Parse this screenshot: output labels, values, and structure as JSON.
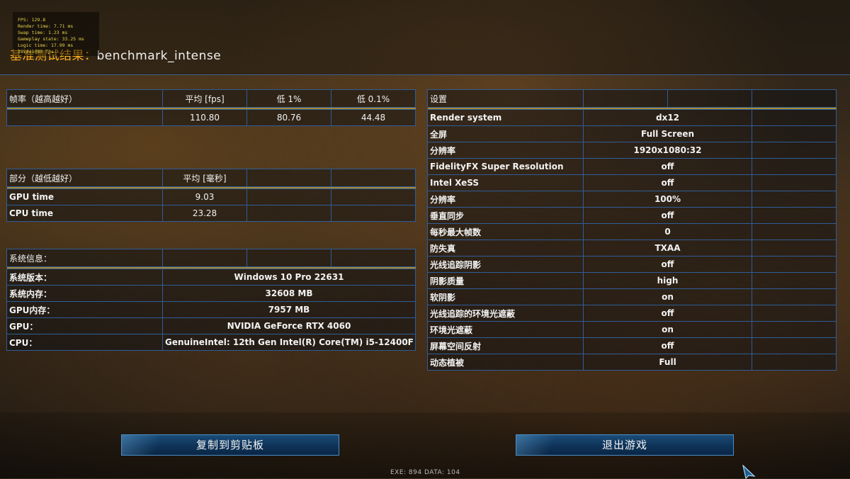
{
  "page_title_prefix": "基准测试结果：",
  "page_title_name": "benchmark_intense",
  "perf_overlay": {
    "fps": "FPS: 129.8",
    "render_time": "Render time: 7.71 ms",
    "swap_time": "Swap time: 1.23 ms",
    "gameplay_state": "Gameplay state: 33.25 ms",
    "logic_time": "Logic time: 17.99 ms",
    "resolution": "1920x1080 fps"
  },
  "fps_table": {
    "header": {
      "label": "帧率（越高越好）",
      "avg": "平均 [fps]",
      "low1": "低 1%",
      "low01": "低 0.1%"
    },
    "row": {
      "avg": "110.80",
      "low1": "80.76",
      "low01": "44.48"
    }
  },
  "parts_table": {
    "header": {
      "label": "部分（越低越好）",
      "avg": "平均 [毫秒]"
    },
    "rows": [
      {
        "label": "GPU time",
        "value": "9.03"
      },
      {
        "label": "CPU time",
        "value": "23.28"
      }
    ]
  },
  "system_table": {
    "header": {
      "label": "系统信息："
    },
    "rows": [
      {
        "label": "系统版本：",
        "value": "Windows 10 Pro 22631"
      },
      {
        "label": "系统内存：",
        "value": "32608 MB"
      },
      {
        "label": "GPU内存：",
        "value": "7957 MB"
      },
      {
        "label": "GPU：",
        "value": "NVIDIA GeForce RTX 4060"
      },
      {
        "label": "CPU：",
        "value": "GenuineIntel: 12th Gen Intel(R) Core(TM) i5-12400F"
      }
    ]
  },
  "settings_table": {
    "header": {
      "label": "设置"
    },
    "rows": [
      {
        "label": "Render system",
        "value": "dx12"
      },
      {
        "label": "全屏",
        "value": "Full Screen"
      },
      {
        "label": "分辨率",
        "value": "1920x1080:32"
      },
      {
        "label": "FidelityFX Super Resolution",
        "value": "off"
      },
      {
        "label": "Intel XeSS",
        "value": "off"
      },
      {
        "label": "分辨率",
        "value": "100%"
      },
      {
        "label": "垂直同步",
        "value": "off"
      },
      {
        "label": "每秒最大帧数",
        "value": "0"
      },
      {
        "label": "防失真",
        "value": "TXAA"
      },
      {
        "label": "光线追踪阴影",
        "value": "off"
      },
      {
        "label": "阴影质量",
        "value": "high"
      },
      {
        "label": "软阴影",
        "value": "on"
      },
      {
        "label": "光线追踪的环境光遮蔽",
        "value": "off"
      },
      {
        "label": "环境光遮蔽",
        "value": "on"
      },
      {
        "label": "屏幕空间反射",
        "value": "off"
      },
      {
        "label": "动态植被",
        "value": "Full"
      }
    ]
  },
  "buttons": {
    "copy_label": "复制到剪贴板",
    "quit_label": "退出游戏"
  },
  "footer": {
    "exe_data": "EXE: 894  DATA: 104"
  },
  "colors": {
    "border": "#2f5d98",
    "accent_gold": "#ffb11a",
    "button_fill": "#0f3358"
  },
  "icons": {
    "cursor": "cursor-arrow-icon"
  }
}
